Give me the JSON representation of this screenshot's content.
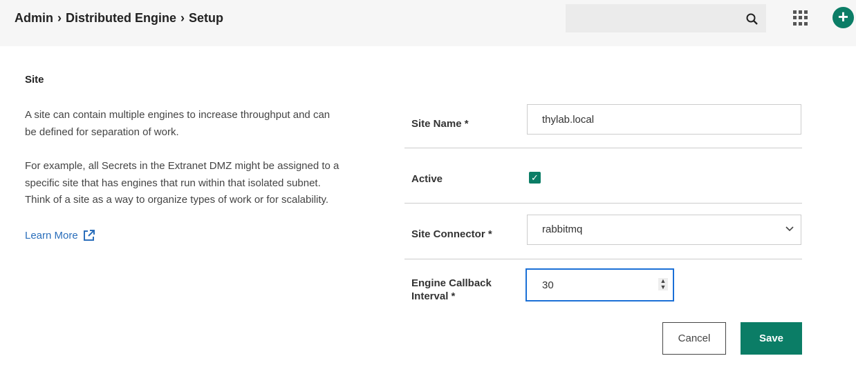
{
  "header": {
    "breadcrumb": [
      "Admin",
      "Distributed Engine",
      "Setup"
    ],
    "separator": "›",
    "search_placeholder": "",
    "accent": "#0b7d66"
  },
  "info": {
    "title": "Site",
    "paragraph1": "A site can contain multiple engines to increase throughput and can be defined for separation of work.",
    "paragraph2": "For example, all Secrets in the Extranet DMZ might be assigned to a specific site that has engines that run within that isolated subnet. Think of a site as a way to organize types of work or for scalability.",
    "learn_more": "Learn More"
  },
  "form": {
    "site_name": {
      "label": "Site Name",
      "required": "*",
      "value": "thylab.local"
    },
    "active": {
      "label": "Active",
      "checked": true
    },
    "site_connector": {
      "label": "Site Connector",
      "required": "*",
      "value": "rabbitmq"
    },
    "callback_interval": {
      "label_line1": "Engine Callback",
      "label_line2": "Interval",
      "required": "*",
      "value": "30"
    }
  },
  "actions": {
    "cancel": "Cancel",
    "save": "Save"
  }
}
